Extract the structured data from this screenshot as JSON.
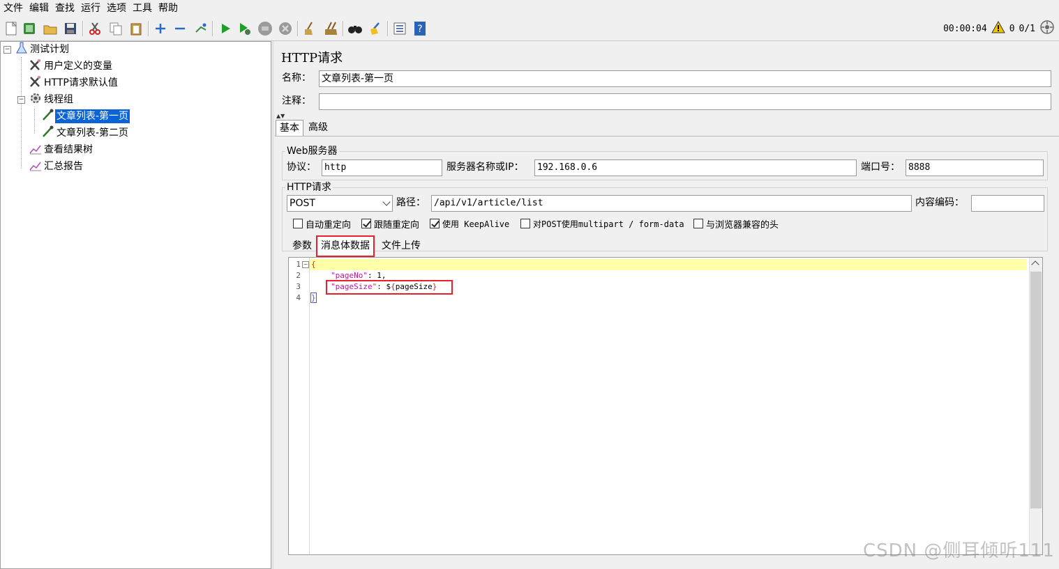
{
  "menu": [
    "文件",
    "编辑",
    "查找",
    "运行",
    "选项",
    "工具",
    "帮助"
  ],
  "toolbar": {
    "timer": "00:00:04",
    "warning_count": "0",
    "threads": "0/1",
    "icons": [
      "new-icon",
      "templates-icon",
      "open-icon",
      "save-icon",
      "cut-icon",
      "copy-icon",
      "paste-icon",
      "expand-icon",
      "collapse-icon",
      "toggle-icon",
      "start-icon",
      "start-no-pause-icon",
      "stop-icon",
      "shutdown-icon",
      "clear-icon",
      "clear-all-icon",
      "search-icon",
      "reset-search-icon",
      "function-helper-icon",
      "help-icon"
    ]
  },
  "tree": {
    "items": [
      {
        "label": "测试计划",
        "icon": "flask-icon"
      },
      {
        "label": "用户定义的变量",
        "icon": "wrench-icon"
      },
      {
        "label": "HTTP请求默认值",
        "icon": "wrench-icon"
      },
      {
        "label": "线程组",
        "icon": "gear-icon"
      },
      {
        "label": "文章列表-第一页",
        "icon": "pipette-icon"
      },
      {
        "label": "文章列表-第二页",
        "icon": "pipette-icon"
      },
      {
        "label": "查看结果树",
        "icon": "chart-icon"
      },
      {
        "label": "汇总报告",
        "icon": "chart-icon"
      }
    ]
  },
  "panel": {
    "title": "HTTP请求",
    "name_label": "名称：",
    "name_value": "文章列表-第一页",
    "comment_label": "注释：",
    "comment_value": "",
    "tabs": [
      "基本",
      "高级"
    ],
    "web_server": {
      "group_title": "Web服务器",
      "protocol_label": "协议：",
      "protocol_value": "http",
      "server_label": "服务器名称或IP：",
      "server_value": "192.168.0.6",
      "port_label": "端口号：",
      "port_value": "8888"
    },
    "http_request": {
      "group_title": "HTTP请求",
      "method": "POST",
      "path_label": "路径：",
      "path_value": "/api/v1/article/list",
      "encoding_label": "内容编码：",
      "encoding_value": "",
      "checkboxes": [
        {
          "label": "自动重定向",
          "checked": false
        },
        {
          "label": "跟随重定向",
          "checked": true
        },
        {
          "label": "使用 KeepAlive",
          "checked": true
        },
        {
          "label": "对POST使用multipart / form-data",
          "checked": false
        },
        {
          "label": "与浏览器兼容的头",
          "checked": false
        }
      ],
      "subtabs": [
        "参数",
        "消息体数据",
        "文件上传"
      ]
    },
    "body": {
      "line_numbers": [
        "1",
        "2",
        "3",
        "4"
      ],
      "line1_open": "{",
      "line2_key": "\"pageNo\"",
      "line2_rest": ": 1,",
      "line3_key": "\"pageSize\"",
      "line3_colon": ": ",
      "line3_value_prefix": "$",
      "line3_value_brace_open": "{",
      "line3_value_name": "pageSize",
      "line3_value_brace_close": "}",
      "line4_close": "}"
    }
  },
  "watermark": "CSDN @侧耳倾听111"
}
